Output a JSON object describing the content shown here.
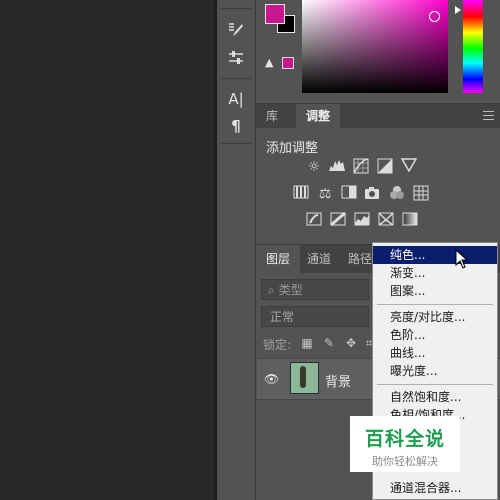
{
  "colors": {
    "foreground": "#c8168f",
    "background": "#000000",
    "accent_highlight": "#0b1e6e"
  },
  "adjustments_panel": {
    "tabs": [
      {
        "label": "库"
      },
      {
        "label": "调整"
      }
    ],
    "title": "添加调整",
    "icons": [
      "brightness-icon",
      "levels-icon",
      "curves-icon",
      "exposure-icon",
      "vibrance-icon",
      "hue-saturation-icon",
      "color-balance-icon",
      "black-white-icon",
      "photo-filter-icon",
      "channel-mixer-icon",
      "color-lookup-icon",
      "invert-icon",
      "posterize-icon",
      "threshold-icon",
      "selective-color-icon",
      "gradient-map-icon"
    ]
  },
  "layers_panel": {
    "tabs": [
      {
        "label": "图层"
      },
      {
        "label": "通道"
      },
      {
        "label": "路径"
      }
    ],
    "filter_label": "类型",
    "blend_mode": "正常",
    "lock_label": "锁定:",
    "layer": {
      "name": "背景"
    }
  },
  "context_menu": {
    "items": [
      {
        "label": "纯色..."
      },
      {
        "label": "渐变..."
      },
      {
        "label": "图案..."
      },
      {
        "label": "亮度/对比度..."
      },
      {
        "label": "色阶..."
      },
      {
        "label": "曲线..."
      },
      {
        "label": "曝光度..."
      },
      {
        "label": "自然饱和度..."
      },
      {
        "label": "色相/饱和度..."
      },
      {
        "label": "通道混合器..."
      }
    ]
  },
  "watermark": {
    "title": "百科全说",
    "subtitle": "助你轻松解决"
  }
}
